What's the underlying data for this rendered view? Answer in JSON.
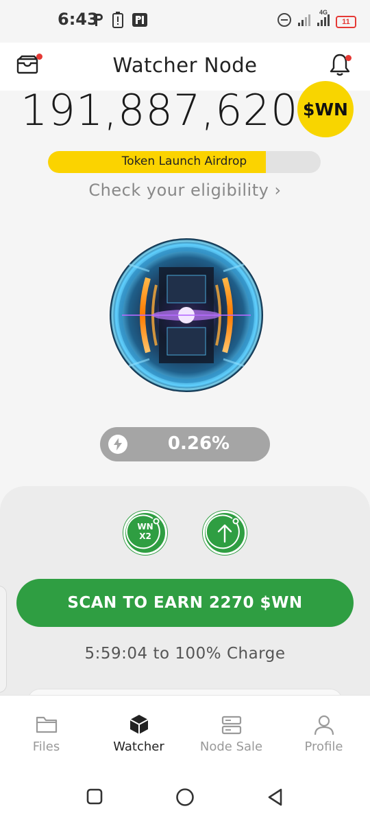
{
  "status_bar": {
    "time": "6:43",
    "left_icons": [
      "p-app-icon",
      "battery-alert-icon",
      "parking-icon"
    ],
    "right_icons": [
      "do-not-disturb-icon",
      "signal-icon",
      "4g-signal-icon",
      "battery-icon"
    ],
    "network_label": "4G",
    "battery_level": "11"
  },
  "header": {
    "title": "Watcher Node",
    "left_icon": "wallet-icon",
    "right_icon": "bell-icon"
  },
  "balance": {
    "value": "191,887,620",
    "token_badge": "$WN"
  },
  "airdrop": {
    "label": "Token Launch Airdrop",
    "progress": 0.8,
    "fill_color": "#fbd300"
  },
  "eligibility": {
    "text": "Check your eligibility",
    "chevron": "›"
  },
  "charge": {
    "icon": "bolt-icon",
    "value": "0.26%"
  },
  "actions": {
    "boost_line1": "WN",
    "boost_line2": "X2",
    "upgrade_icon": "arrow-up-icon",
    "scan_label": "SCAN TO EARN 2270 $WN",
    "timer": "5:59:04 to 100% Charge",
    "accent_color": "#2f9e42"
  },
  "nav": {
    "items": [
      {
        "label": "Files",
        "icon": "folder-icon"
      },
      {
        "label": "Watcher",
        "icon": "cube-icon"
      },
      {
        "label": "Node Sale",
        "icon": "server-icon"
      },
      {
        "label": "Profile",
        "icon": "person-icon"
      }
    ],
    "active_index": 1
  },
  "system_nav": [
    "recents-square-icon",
    "home-circle-icon",
    "back-triangle-icon"
  ]
}
